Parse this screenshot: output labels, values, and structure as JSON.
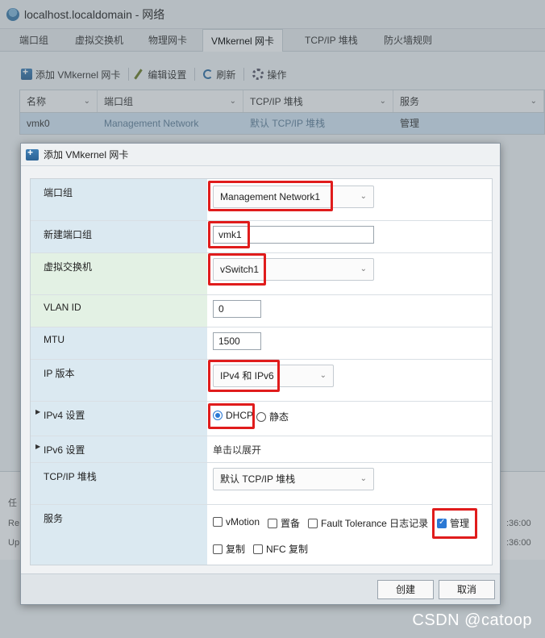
{
  "window": {
    "title": "localhost.localdomain - 网络"
  },
  "tabs": [
    "端口组",
    "虚拟交换机",
    "物理网卡",
    "VMkernel 网卡",
    "TCP/IP 堆栈",
    "防火墙规则"
  ],
  "toolbar": {
    "add": "添加 VMkernel 网卡",
    "edit": "编辑设置",
    "refresh": "刷新",
    "actions": "操作"
  },
  "grid": {
    "columns": [
      "名称",
      "端口组",
      "TCP/IP 堆栈",
      "服务"
    ],
    "row": {
      "name": "vmk0",
      "portgroup": "Management Network",
      "stack": "默认 TCP/IP 堆栈",
      "service": "管理"
    }
  },
  "bottom": {
    "r1": "Re",
    "r2": "Up",
    "t1": ":36:00",
    "t2": ":36:00",
    "h": "任"
  },
  "modal": {
    "title": "添加 VMkernel 网卡",
    "labels": {
      "portgroup": "端口组",
      "new_portgroup": "新建端口组",
      "vswitch": "虚拟交换机",
      "vlan": "VLAN ID",
      "mtu": "MTU",
      "ipver": "IP 版本",
      "ipv4": "IPv4 设置",
      "ipv6": "IPv6 设置",
      "stack": "TCP/IP 堆栈",
      "services": "服务"
    },
    "values": {
      "portgroup": "Management Network1",
      "new_portgroup": "vmk1",
      "vswitch": "vSwitch1",
      "vlan": "0",
      "mtu": "1500",
      "ipver": "IPv4 和 IPv6",
      "dhcp": "DHCP",
      "static": "静态",
      "ipv6_hint": "单击以展开",
      "stack": "默认 TCP/IP 堆栈"
    },
    "services": {
      "vmotion": "vMotion",
      "provision": "置备",
      "ft": "Fault Tolerance 日志记录",
      "mgmt": "管理",
      "replication": "复制",
      "nfc": "NFC 复制"
    },
    "buttons": {
      "create": "创建",
      "cancel": "取消"
    }
  },
  "watermark": "CSDN @catoop"
}
